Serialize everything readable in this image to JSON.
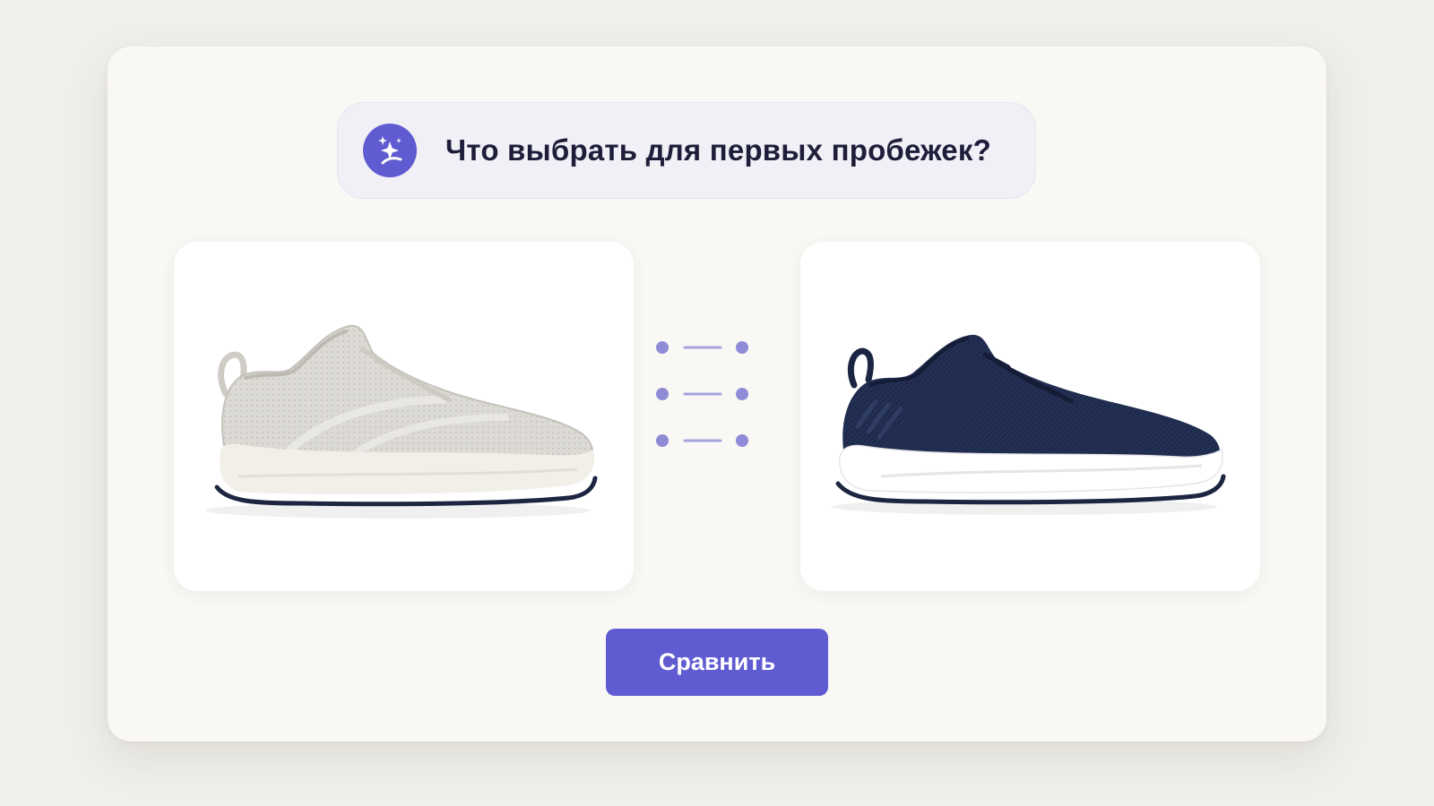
{
  "question": {
    "icon": "sparkles-icon",
    "text": "Что выбрать для первых пробежек?"
  },
  "products": [
    {
      "icon": "sneaker-light-icon",
      "color": "#d9d7d2"
    },
    {
      "icon": "sneaker-navy-icon",
      "color": "#202c4b"
    }
  ],
  "compare": {
    "icon": "compare-lines-icon",
    "button_label": "Сравнить"
  },
  "colors": {
    "accent": "#5f5bd1",
    "background": "#f1efea",
    "panel": "#f9f8f5"
  }
}
